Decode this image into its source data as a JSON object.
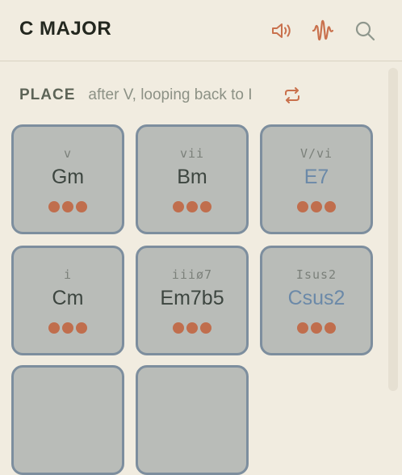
{
  "header": {
    "title": "C MAJOR",
    "icons": [
      "speaker-icon",
      "waveform-icon",
      "search-icon"
    ]
  },
  "place": {
    "label": "PLACE",
    "text": "after V, looping back to I",
    "loop_icon": "repeat-icon"
  },
  "colors": {
    "background": "#f1ece0",
    "accent": "#c9714d",
    "card_bg": "#b9bcb8",
    "card_border": "#7d8e9e",
    "chord_text": "#3d4640",
    "borrowed_chord_text": "#6b89a8",
    "dot": "#c06e4d"
  },
  "cards": [
    {
      "numeral": "v",
      "chord": "Gm",
      "dots": 3,
      "borrowed": false
    },
    {
      "numeral": "vii",
      "chord": "Bm",
      "dots": 3,
      "borrowed": false
    },
    {
      "numeral": "V/vi",
      "chord": "E7",
      "dots": 3,
      "borrowed": true
    },
    {
      "numeral": "i",
      "chord": "Cm",
      "dots": 3,
      "borrowed": false
    },
    {
      "numeral": "iiiø7",
      "chord": "Em7b5",
      "dots": 3,
      "borrowed": false
    },
    {
      "numeral": "Isus2",
      "chord": "Csus2",
      "dots": 3,
      "borrowed": true
    },
    {
      "numeral": "",
      "chord": "",
      "dots": 0,
      "borrowed": false
    },
    {
      "numeral": "",
      "chord": "",
      "dots": 0,
      "borrowed": false
    }
  ]
}
